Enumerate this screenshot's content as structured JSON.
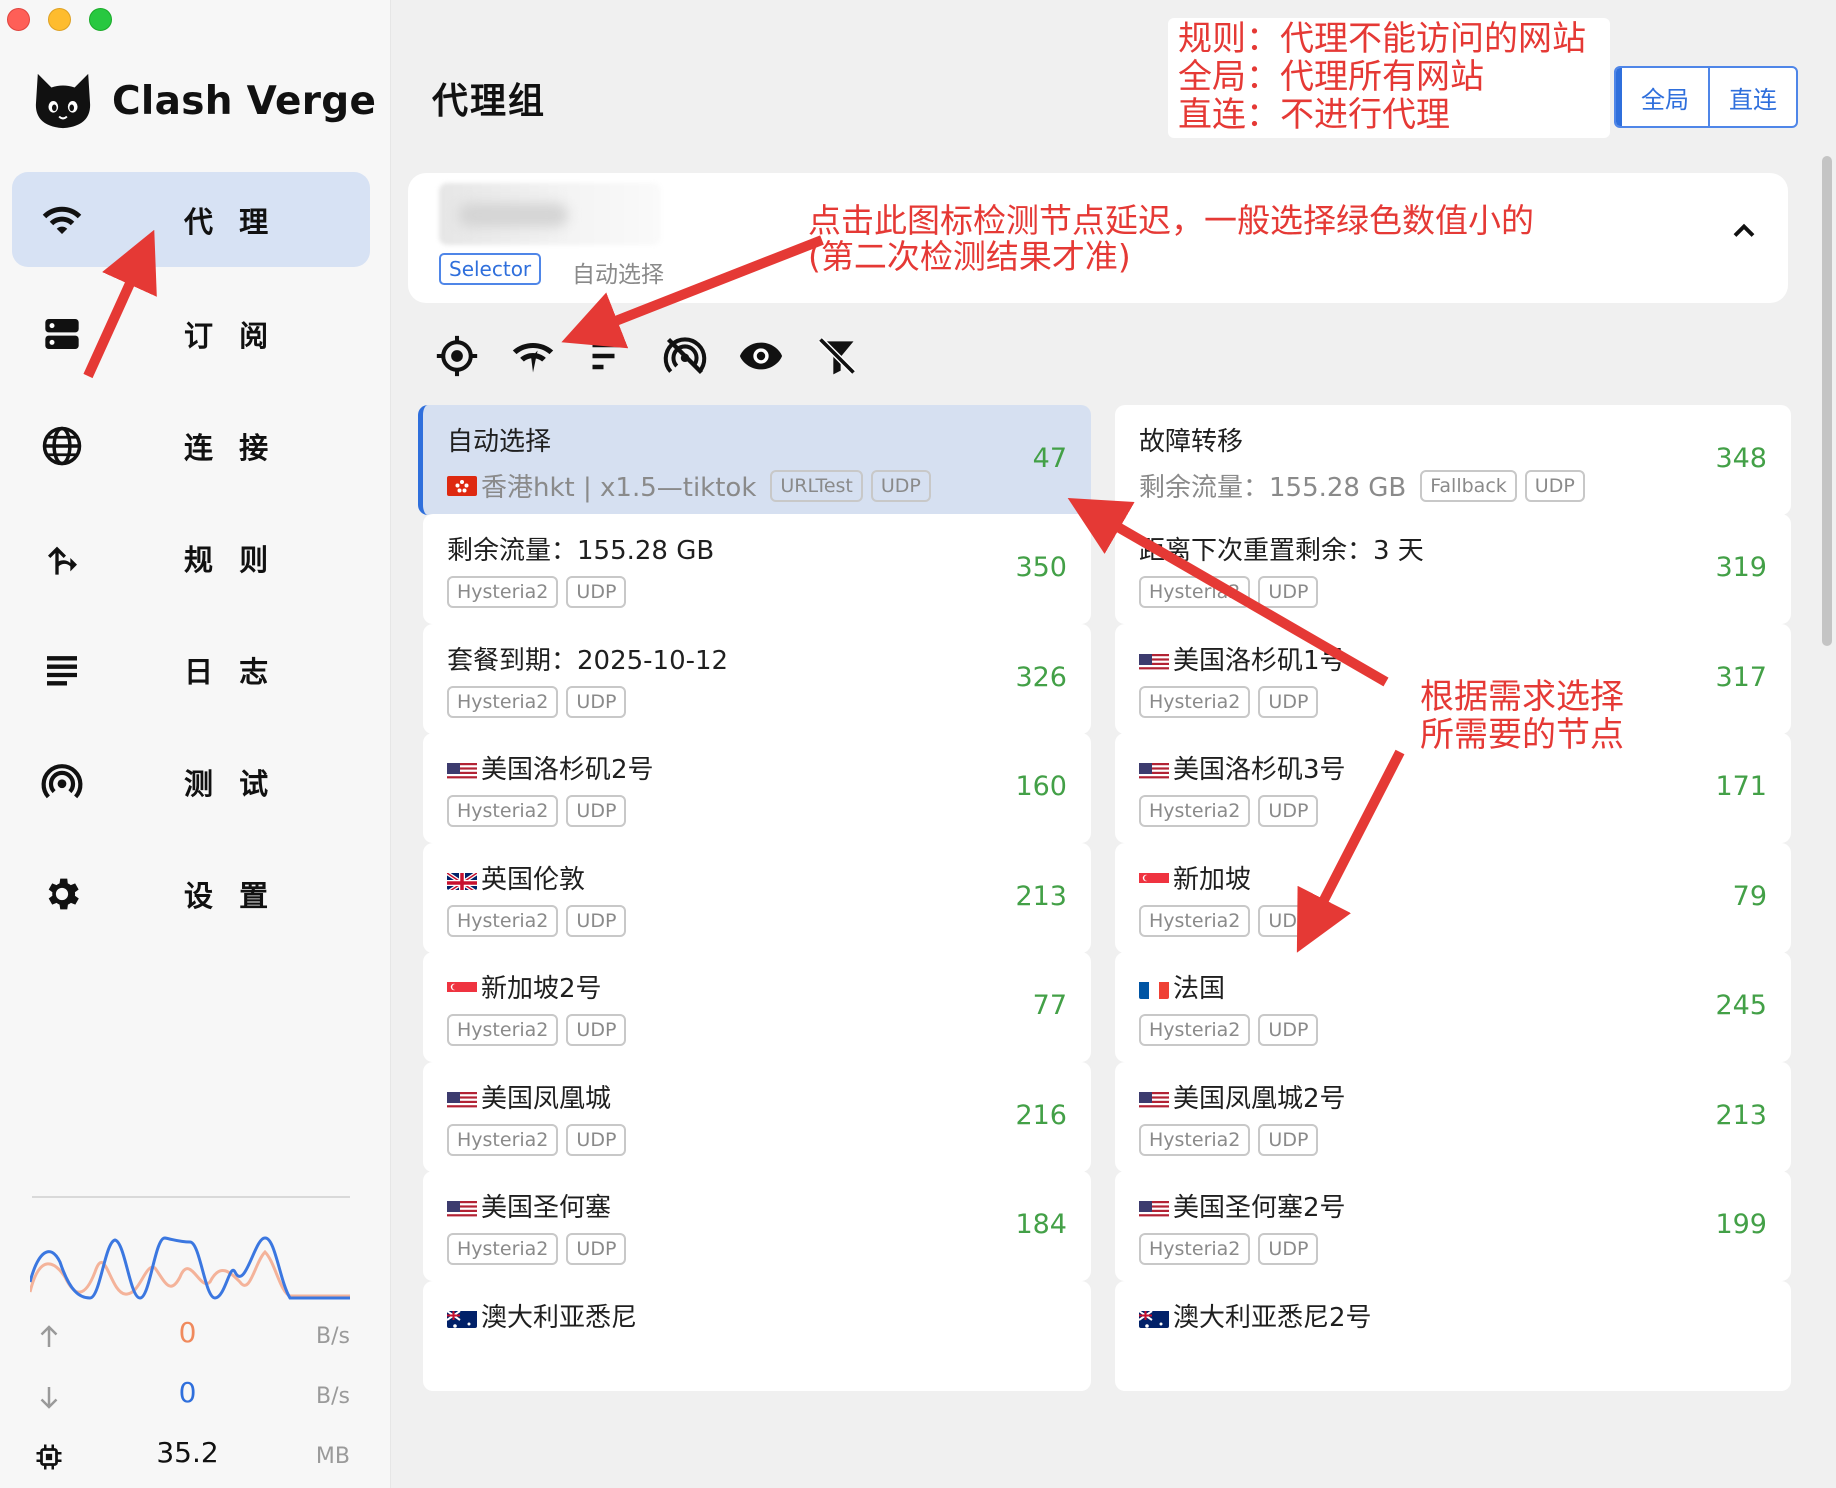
{
  "app": {
    "name": "Clash Verge"
  },
  "sidebar": {
    "items": [
      {
        "label": "代 理",
        "icon": "wifi-icon",
        "active": true
      },
      {
        "label": "订 阅",
        "icon": "server-icon",
        "active": false
      },
      {
        "label": "连 接",
        "icon": "globe-icon",
        "active": false
      },
      {
        "label": "规 则",
        "icon": "route-icon",
        "active": false
      },
      {
        "label": "日 志",
        "icon": "list-icon",
        "active": false
      },
      {
        "label": "测 试",
        "icon": "radar-icon",
        "active": false
      },
      {
        "label": "设 置",
        "icon": "gear-icon",
        "active": false
      }
    ],
    "traffic": {
      "upload": {
        "value": "0",
        "unit": "B/s"
      },
      "download": {
        "value": "0",
        "unit": "B/s"
      },
      "memory": {
        "value": "35.2",
        "unit": "MB"
      }
    }
  },
  "header": {
    "title": "代理组",
    "modes": [
      {
        "label": "全局",
        "active": true
      },
      {
        "label": "直连",
        "active": false
      }
    ]
  },
  "annotations": {
    "mode": [
      "规则：代理不能访问的网站",
      "全局：代理所有网站",
      "直连：不进行代理"
    ],
    "latency": [
      "点击此图标检测节点延迟，一般选择绿色数值小的",
      "(第二次检测结果才准)"
    ],
    "choose": [
      "根据需求选择",
      "所需要的节点"
    ]
  },
  "group": {
    "type": "Selector",
    "now": "自动选择"
  },
  "toolbar": [
    "locate-icon",
    "delay-check-icon",
    "sort-icon",
    "hide-unavailable-icon",
    "show-type-icon",
    "filter-off-icon"
  ],
  "proxies": [
    {
      "name": "自动选择",
      "now": "香港hkt | x1.5—tiktok",
      "now_flag": "hk",
      "tags": [
        "URLTest",
        "UDP"
      ],
      "delay": "47",
      "selected": true
    },
    {
      "name": "故障转移",
      "now": "剩余流量：155.28 GB",
      "now_flag": "",
      "tags": [
        "Fallback",
        "UDP"
      ],
      "delay": "348",
      "selected": false
    },
    {
      "name": "剩余流量：155.28 GB",
      "flag": "",
      "tags": [
        "Hysteria2",
        "UDP"
      ],
      "delay": "350"
    },
    {
      "name": "距离下次重置剩余：3 天",
      "flag": "",
      "tags": [
        "Hysteria2",
        "UDP"
      ],
      "delay": "319"
    },
    {
      "name": "套餐到期：2025-10-12",
      "flag": "",
      "tags": [
        "Hysteria2",
        "UDP"
      ],
      "delay": "326"
    },
    {
      "name": "美国洛杉矶1号",
      "flag": "us",
      "tags": [
        "Hysteria2",
        "UDP"
      ],
      "delay": "317"
    },
    {
      "name": "美国洛杉矶2号",
      "flag": "us",
      "tags": [
        "Hysteria2",
        "UDP"
      ],
      "delay": "160"
    },
    {
      "name": "美国洛杉矶3号",
      "flag": "us",
      "tags": [
        "Hysteria2",
        "UDP"
      ],
      "delay": "171"
    },
    {
      "name": "英国伦敦",
      "flag": "gb",
      "tags": [
        "Hysteria2",
        "UDP"
      ],
      "delay": "213"
    },
    {
      "name": "新加坡",
      "flag": "sg",
      "tags": [
        "Hysteria2",
        "UDP"
      ],
      "delay": "79"
    },
    {
      "name": "新加坡2号",
      "flag": "sg",
      "tags": [
        "Hysteria2",
        "UDP"
      ],
      "delay": "77"
    },
    {
      "name": "法国",
      "flag": "fr",
      "tags": [
        "Hysteria2",
        "UDP"
      ],
      "delay": "245"
    },
    {
      "name": "美国凤凰城",
      "flag": "us",
      "tags": [
        "Hysteria2",
        "UDP"
      ],
      "delay": "216"
    },
    {
      "name": "美国凤凰城2号",
      "flag": "us",
      "tags": [
        "Hysteria2",
        "UDP"
      ],
      "delay": "213"
    },
    {
      "name": "美国圣何塞",
      "flag": "us",
      "tags": [
        "Hysteria2",
        "UDP"
      ],
      "delay": "184"
    },
    {
      "name": "美国圣何塞2号",
      "flag": "us",
      "tags": [
        "Hysteria2",
        "UDP"
      ],
      "delay": "199"
    },
    {
      "name": "澳大利亚悉尼",
      "flag": "au",
      "tags": [],
      "delay": ""
    },
    {
      "name": "澳大利亚悉尼2号",
      "flag": "au",
      "tags": [],
      "delay": ""
    }
  ],
  "colors": {
    "accent": "#2f6fdc",
    "selected_bg": "#d6e0f1",
    "delay_green": "#43a047",
    "annotation_red": "#e53935"
  }
}
